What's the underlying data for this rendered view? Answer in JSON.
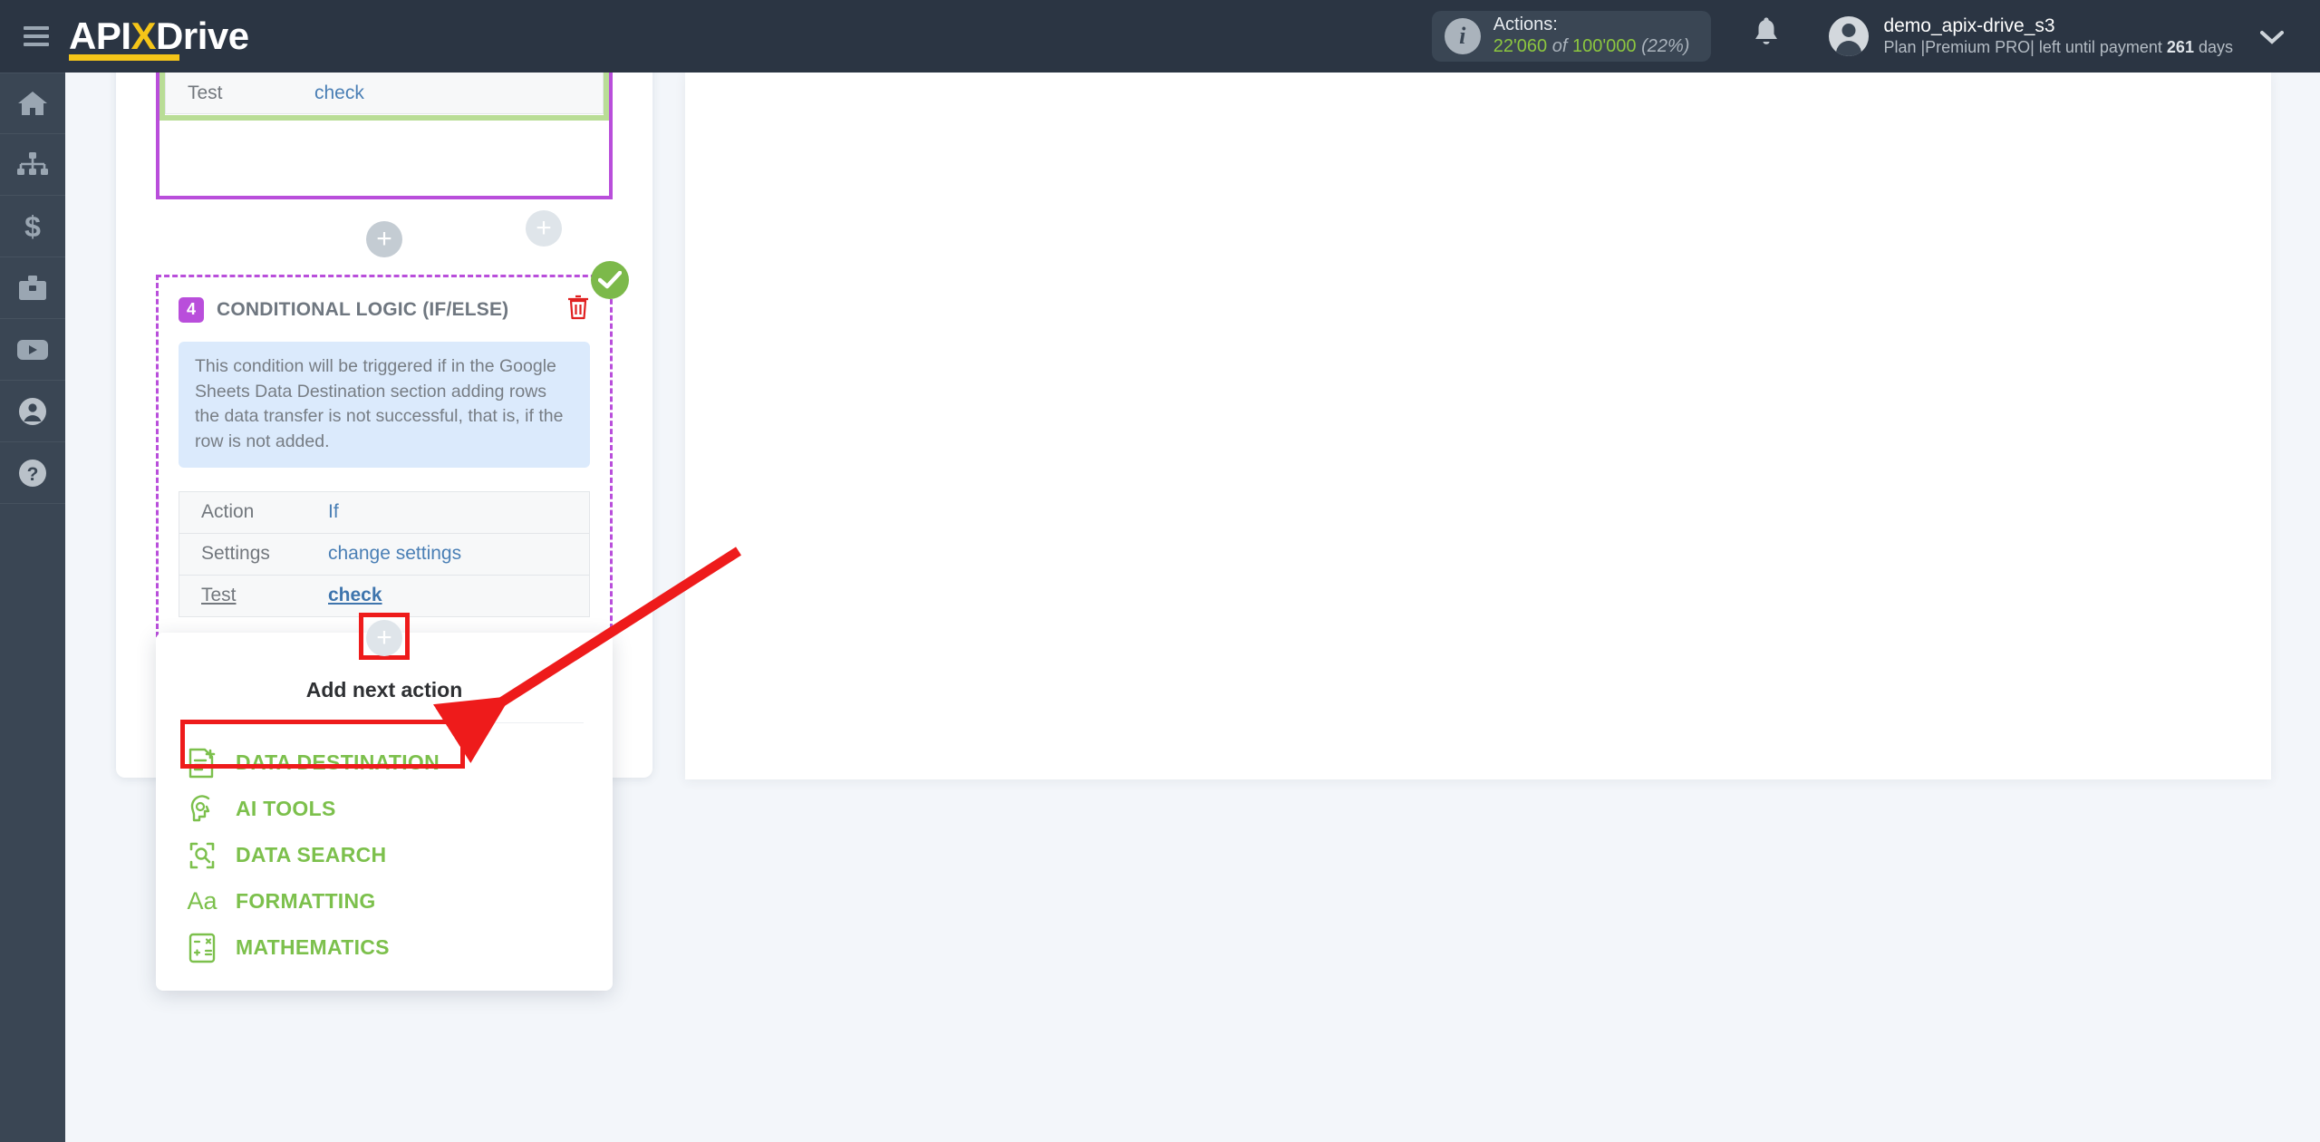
{
  "header": {
    "logo_api": "API",
    "logo_x": "X",
    "logo_drive": "Drive",
    "menu_icon": "hamburger-icon",
    "actions": {
      "label": "Actions:",
      "used": "22'060",
      "of": "of",
      "total": "100'000",
      "percent": "(22%)"
    },
    "bell_icon": "bell-icon",
    "user": {
      "name": "demo_apix-drive_s3",
      "plan_prefix": "Plan |",
      "plan_name": "Premium PRO",
      "plan_mid": "| left until payment ",
      "days": "261",
      "days_suffix": " days"
    },
    "chevron": "⌄"
  },
  "sidebar": {
    "items": [
      {
        "name": "home-icon",
        "label": "Home"
      },
      {
        "name": "connections-icon",
        "label": "Connections"
      },
      {
        "name": "billing-icon",
        "label": "Billing"
      },
      {
        "name": "briefcase-icon",
        "label": "Services"
      },
      {
        "name": "youtube-icon",
        "label": "Video"
      },
      {
        "name": "profile-icon",
        "label": "Profile"
      },
      {
        "name": "help-icon",
        "label": "Help"
      }
    ]
  },
  "workflow": {
    "top_card": {
      "test_label": "Test",
      "test_value": "check"
    },
    "conditional_card": {
      "number": "4",
      "title": "CONDITIONAL LOGIC (IF/ELSE)",
      "delete_icon": "trash-icon",
      "status_icon": "check-circle-icon",
      "description": "This condition will be triggered if in the Google Sheets Data Destination section adding rows the data transfer is not successful, that is, if the row is not added.",
      "rows": [
        {
          "key": "Action",
          "value": "If",
          "underlined": false
        },
        {
          "key": "Settings",
          "value": "change settings",
          "underlined": false
        },
        {
          "key": "Test",
          "value": "check",
          "underlined": true
        }
      ]
    },
    "add_button_label": "+"
  },
  "menu": {
    "title": "Add next action",
    "items": [
      {
        "icon": "document-add-icon",
        "label": "DATA DESTINATION"
      },
      {
        "icon": "ai-brain-icon",
        "label": "AI TOOLS"
      },
      {
        "icon": "search-scan-icon",
        "label": "DATA SEARCH"
      },
      {
        "icon": "text-format-icon",
        "label": "FORMATTING"
      },
      {
        "icon": "calculator-icon",
        "label": "MATHEMATICS"
      }
    ]
  },
  "annotations": {
    "highlight_plus": "red-box-around-plus-button",
    "highlight_menu_item": "red-box-around-data-destination",
    "arrow": "red-arrow-pointing-to-data-destination"
  },
  "colors": {
    "topbar": "#2b3543",
    "rail": "#3a4654",
    "page_bg": "#f3f6fa",
    "accent_green": "#7cc04c",
    "accent_purple": "#b94edb",
    "accent_yellow": "#f5c518",
    "annotation_red": "#ee1b1b",
    "link_blue": "#4a7fb5",
    "info_box_blue": "#dbeafc"
  }
}
